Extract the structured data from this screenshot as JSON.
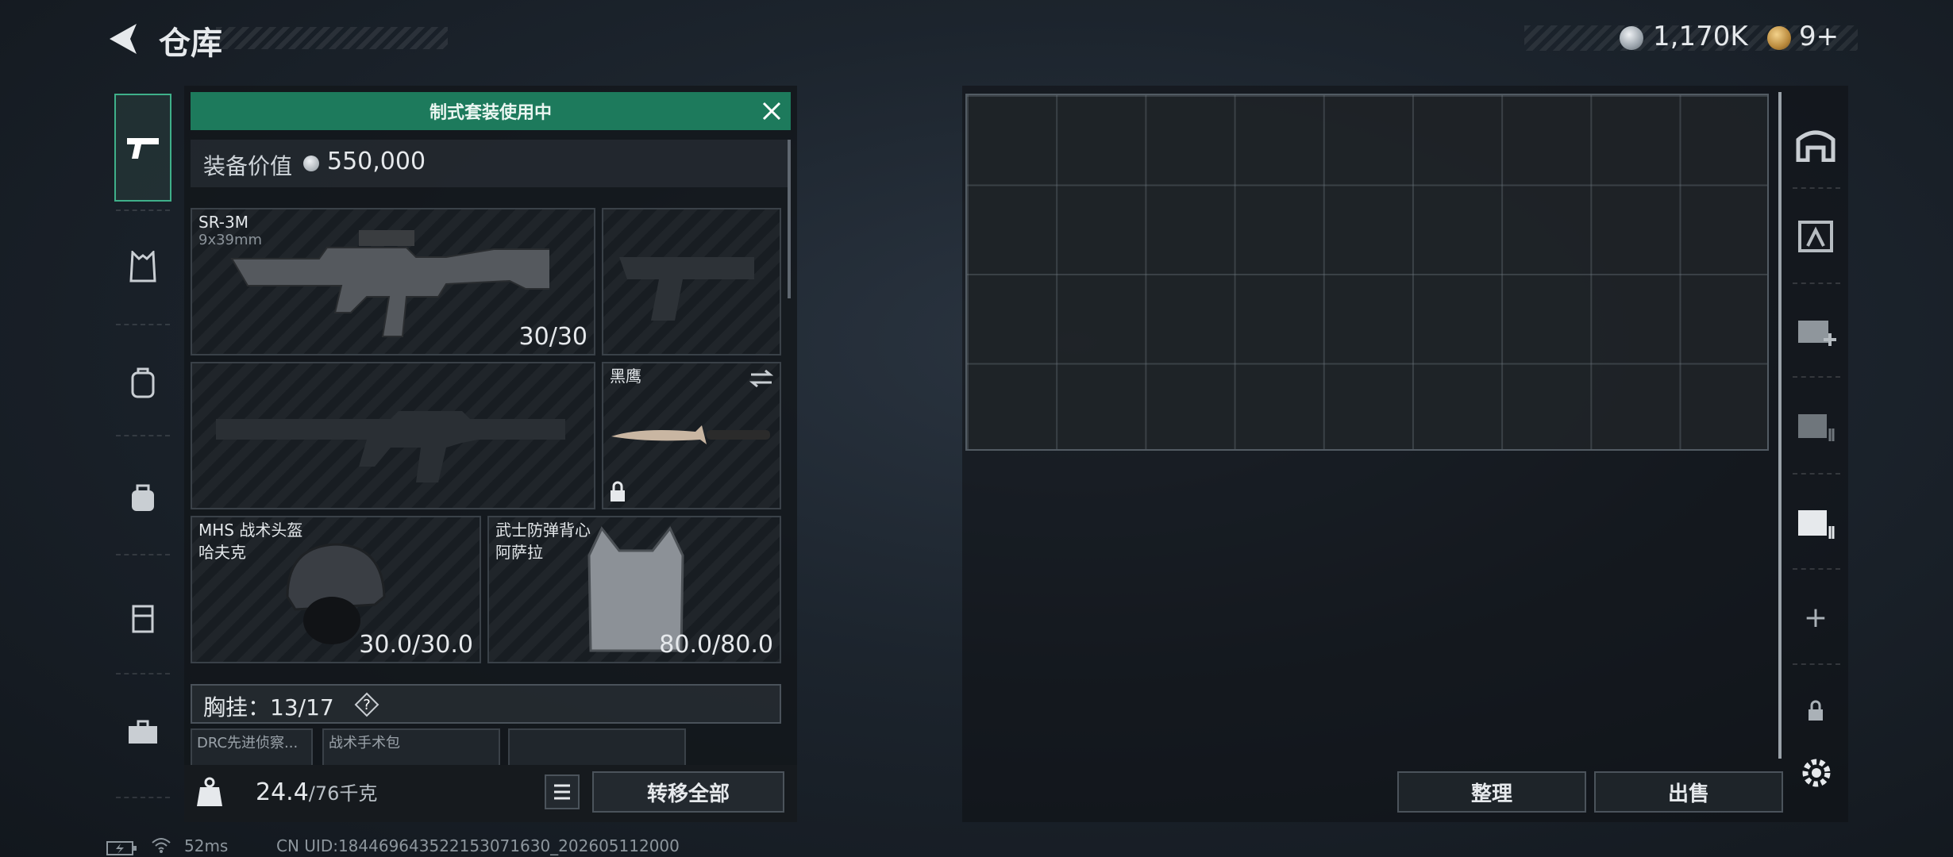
{
  "header": {
    "title": "仓库",
    "money": "1,170K",
    "tickets": "9+",
    "version": "ꟷꟷ ꟷ ꟷ"
  },
  "equipment": {
    "banner": "制式套装使用中",
    "value_label": "装备价值",
    "value": "550,000",
    "primary": {
      "name": "SR-3M",
      "caliber": "9x39mm",
      "durability": "30/30"
    },
    "melee": {
      "name": "黑鹰"
    },
    "helmet": {
      "name": "MHS 战术头盔",
      "sub": "哈夫克",
      "durability": "30.0/30.0"
    },
    "armor": {
      "name": "武士防弹背心",
      "sub": "阿萨拉",
      "durability": "80.0/80.0"
    },
    "chest_rig": {
      "label": "胸挂：",
      "count": "13/17",
      "help": "?"
    },
    "mini_slots": [
      "DRC先进侦察...",
      "战术手术包",
      ""
    ],
    "weight": "24.4",
    "weight_max": "/76千克",
    "transfer_all": "转移全部"
  },
  "storage": {
    "organize": "整理",
    "sell": "出售",
    "add": "+"
  },
  "status": {
    "ping": "52ms",
    "uid": "CN UID:18446964352215307163​0_202605112000"
  }
}
